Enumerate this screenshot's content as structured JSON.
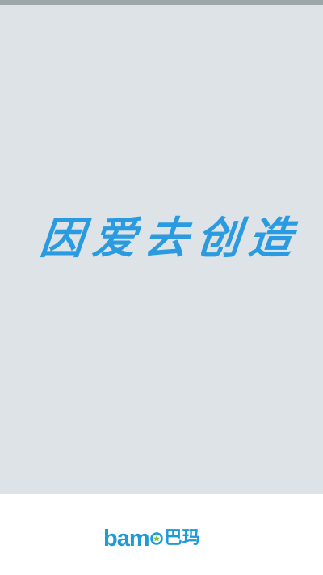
{
  "splash": {
    "slogan_chars": [
      "因",
      "爱",
      "去",
      "创",
      "造"
    ]
  },
  "footer": {
    "logo_latin_1": "b",
    "logo_latin_2": "a",
    "logo_latin_3": "m",
    "logo_cn": "巴玛"
  },
  "colors": {
    "splash_bg": "#dde3e6",
    "slogan": "#2a9be0",
    "brand_blue": "#1e9bd7",
    "brand_green": "#7cc242"
  }
}
